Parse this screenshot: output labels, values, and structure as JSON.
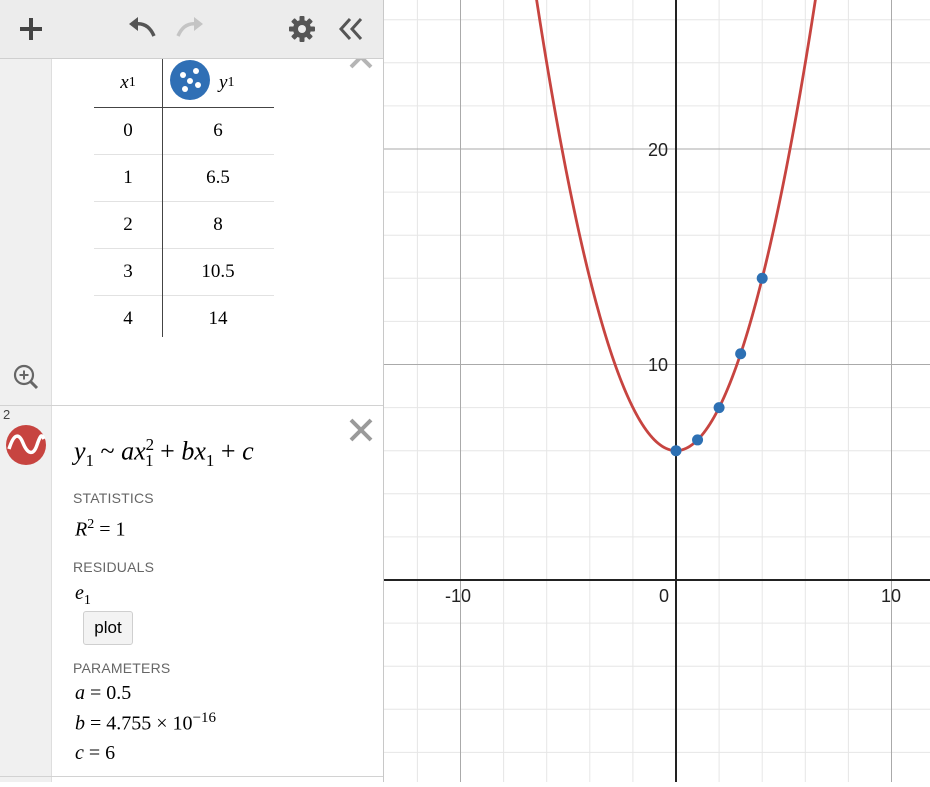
{
  "toolbar": {
    "add": "+",
    "undo": "undo",
    "redo": "redo",
    "settings": "settings",
    "collapse": "collapse"
  },
  "table": {
    "header_x": "x",
    "header_x_sub": "1",
    "header_y": "y",
    "header_y_sub": "1",
    "rows": [
      {
        "x": "0",
        "y": "6"
      },
      {
        "x": "1",
        "y": "6.5"
      },
      {
        "x": "2",
        "y": "8"
      },
      {
        "x": "3",
        "y": "10.5"
      },
      {
        "x": "4",
        "y": "14"
      }
    ]
  },
  "regression": {
    "index": "2",
    "statistics_label": "STATISTICS",
    "r2_lhs": "R",
    "r2_exp": "2",
    "r2_rhs": "= 1",
    "residuals_label": "RESIDUALS",
    "residual_var": "e",
    "residual_sub": "1",
    "plot_label": "plot",
    "parameters_label": "PARAMETERS",
    "a_name": "a",
    "a_value": "= 0.5",
    "b_name": "b",
    "b_value": "= 4.755 × 10",
    "b_exp": "−16",
    "c_name": "c",
    "c_value": "= 6"
  },
  "graph": {
    "ticks_x": [
      "-10",
      "0",
      "10"
    ],
    "ticks_y": [
      "10",
      "20"
    ],
    "points": [
      [
        0,
        6
      ],
      [
        1,
        6.5
      ],
      [
        2,
        8
      ],
      [
        3,
        10.5
      ],
      [
        4,
        14
      ]
    ],
    "curve": {
      "a": 0.5,
      "b": 0,
      "c": 6
    },
    "curve_color": "#c74440",
    "point_color": "#2d70b3"
  }
}
